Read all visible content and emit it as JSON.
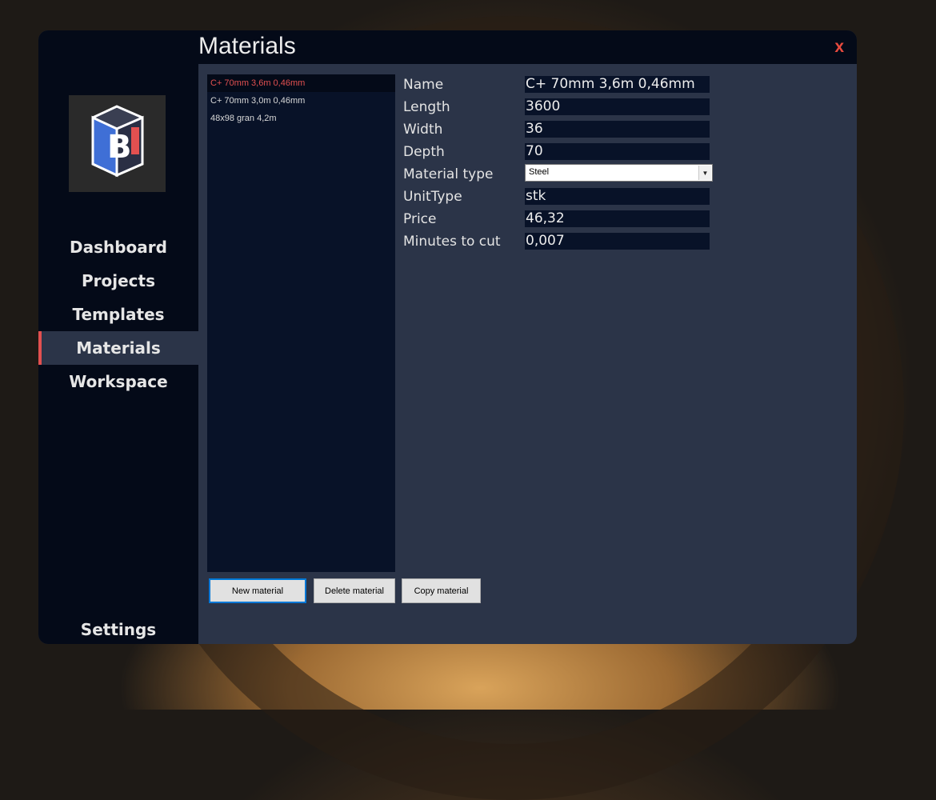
{
  "window": {
    "title": "Materials",
    "close_label": "x"
  },
  "sidebar": {
    "logo_alt": "B",
    "items": [
      {
        "label": "Dashboard"
      },
      {
        "label": "Projects"
      },
      {
        "label": "Templates"
      },
      {
        "label": "Materials",
        "active": true
      },
      {
        "label": "Workspace"
      }
    ],
    "settings_label": "Settings"
  },
  "materials_list": [
    {
      "name": "C+ 70mm 3,6m 0,46mm",
      "selected": true
    },
    {
      "name": "C+ 70mm 3,0m 0,46mm"
    },
    {
      "name": "48x98 gran 4,2m"
    }
  ],
  "form": {
    "name_label": "Name",
    "name_value": "C+ 70mm 3,6m 0,46mm",
    "length_label": "Length",
    "length_value": "3600",
    "width_label": "Width",
    "width_value": "36",
    "depth_label": "Depth",
    "depth_value": "70",
    "material_type_label": "Material type",
    "material_type_value": "Steel",
    "unittype_label": "UnitType",
    "unittype_value": "stk",
    "price_label": "Price",
    "price_value": "46,32",
    "minutes_label": "Minutes to cut",
    "minutes_value": "0,007"
  },
  "buttons": {
    "new_material": "New material",
    "delete_material": "Delete material",
    "copy_material": "Copy material"
  },
  "colors": {
    "accent_red": "#e25050",
    "sidebar_bg": "#040a18",
    "panel_bg": "#2b3448"
  }
}
